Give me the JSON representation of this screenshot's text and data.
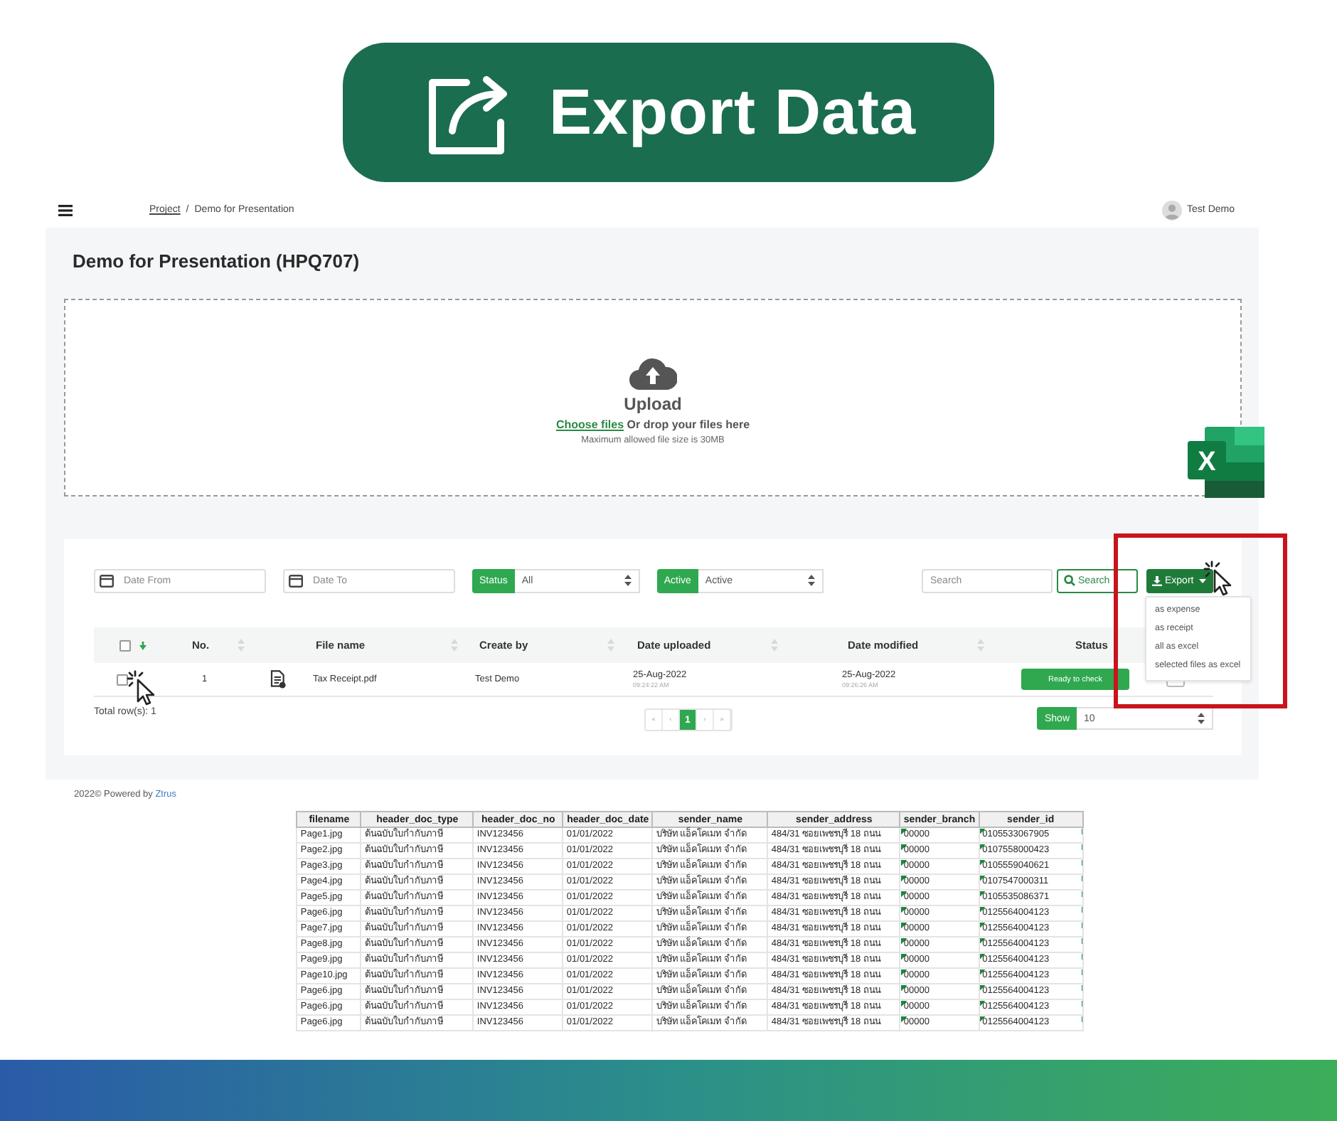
{
  "banner": {
    "title": "Export Data"
  },
  "topbar": {
    "breadcrumb": [
      {
        "label": "Project",
        "link": true
      },
      {
        "label": "Demo for Presentation",
        "link": false
      }
    ],
    "separator": "/",
    "user": "Test Demo"
  },
  "page": {
    "title": "Demo for Presentation (HPQ707)"
  },
  "upload": {
    "title": "Upload",
    "link": "Choose files",
    "text": " Or drop your files here",
    "note": "Maximum allowed file size is 30MB"
  },
  "filters": [
    {
      "kind": "date",
      "placeholder": "Date From"
    },
    {
      "kind": "date",
      "placeholder": "Date To"
    },
    {
      "kind": "select",
      "label": "Status",
      "value": "All"
    },
    {
      "kind": "select",
      "label": "Active",
      "value": "Active"
    }
  ],
  "search": {
    "placeholder": "Search",
    "button": "Search"
  },
  "export": {
    "label": "Export",
    "expanded": true,
    "menu": [
      "as expense",
      "as receipt",
      "all as excel",
      "selected files as excel"
    ]
  },
  "table": {
    "select_all": {
      "checked": false
    },
    "columns": [
      "No.",
      "File name",
      "Create by",
      "Date uploaded",
      "Date modified",
      "Status"
    ],
    "rows": [
      {
        "checked": false,
        "no": "1",
        "file": "Tax Receipt.pdf",
        "created_by": "Test Demo",
        "uploaded_date": "25-Aug-2022",
        "uploaded_time": "09:24:22 AM",
        "modified_date": "25-Aug-2022",
        "modified_time": "09:26:26 AM",
        "status": "Ready to check"
      }
    ],
    "total": "Total row(s): 1",
    "pages": [
      {
        "label": "«",
        "selected": false
      },
      {
        "label": "‹",
        "selected": false
      },
      {
        "label": "1",
        "selected": true
      },
      {
        "label": "›",
        "selected": false
      },
      {
        "label": "»",
        "selected": false
      }
    ],
    "page_size": {
      "label": "Show",
      "value": "10"
    }
  },
  "footer": {
    "text": "2022© Powered by ",
    "link": "Ztrus"
  },
  "excel_icon": {
    "letter": "X"
  },
  "spreadsheet": {
    "columns": [
      "filename",
      "header_doc_type",
      "header_doc_no",
      "header_doc_date",
      "sender_name",
      "sender_address",
      "sender_branch",
      "sender_id"
    ],
    "rows": [
      [
        "Page1.jpg",
        "ต้นฉบับใบกำกับภาษี",
        "INV123456",
        "01/01/2022",
        "บริษัท แอ็คโคเมท จำกัด",
        "484/31 ซอยเพชรบุรี 18 ถนน",
        "00000",
        "0105533067905"
      ],
      [
        "Page2.jpg",
        "ต้นฉบับใบกำกับภาษี",
        "INV123456",
        "01/01/2022",
        "บริษัท แอ็คโคเมท จำกัด",
        "484/31 ซอยเพชรบุรี 18 ถนน",
        "00000",
        "0107558000423"
      ],
      [
        "Page3.jpg",
        "ต้นฉบับใบกำกับภาษี",
        "INV123456",
        "01/01/2022",
        "บริษัท แอ็คโคเมท จำกัด",
        "484/31 ซอยเพชรบุรี 18 ถนน",
        "00000",
        "0105559040621"
      ],
      [
        "Page4.jpg",
        "ต้นฉบับใบกำกับภาษี",
        "INV123456",
        "01/01/2022",
        "บริษัท แอ็คโคเมท จำกัด",
        "484/31 ซอยเพชรบุรี 18 ถนน",
        "00000",
        "0107547000311"
      ],
      [
        "Page5.jpg",
        "ต้นฉบับใบกำกับภาษี",
        "INV123456",
        "01/01/2022",
        "บริษัท แอ็คโคเมท จำกัด",
        "484/31 ซอยเพชรบุรี 18 ถนน",
        "00000",
        "0105535086371"
      ],
      [
        "Page6.jpg",
        "ต้นฉบับใบกำกับภาษี",
        "INV123456",
        "01/01/2022",
        "บริษัท แอ็คโคเมท จำกัด",
        "484/31 ซอยเพชรบุรี 18 ถนน",
        "00000",
        "0125564004123"
      ],
      [
        "Page7.jpg",
        "ต้นฉบับใบกำกับภาษี",
        "INV123456",
        "01/01/2022",
        "บริษัท แอ็คโคเมท จำกัด",
        "484/31 ซอยเพชรบุรี 18 ถนน",
        "00000",
        "0125564004123"
      ],
      [
        "Page8.jpg",
        "ต้นฉบับใบกำกับภาษี",
        "INV123456",
        "01/01/2022",
        "บริษัท แอ็คโคเมท จำกัด",
        "484/31 ซอยเพชรบุรี 18 ถนน",
        "00000",
        "0125564004123"
      ],
      [
        "Page9.jpg",
        "ต้นฉบับใบกำกับภาษี",
        "INV123456",
        "01/01/2022",
        "บริษัท แอ็คโคเมท จำกัด",
        "484/31 ซอยเพชรบุรี 18 ถนน",
        "00000",
        "0125564004123"
      ],
      [
        "Page10.jpg",
        "ต้นฉบับใบกำกับภาษี",
        "INV123456",
        "01/01/2022",
        "บริษัท แอ็คโคเมท จำกัด",
        "484/31 ซอยเพชรบุรี 18 ถนน",
        "00000",
        "0125564004123"
      ],
      [
        "Page6.jpg",
        "ต้นฉบับใบกำกับภาษี",
        "INV123456",
        "01/01/2022",
        "บริษัท แอ็คโคเมท จำกัด",
        "484/31 ซอยเพชรบุรี 18 ถนน",
        "00000",
        "0125564004123"
      ],
      [
        "Page6.jpg",
        "ต้นฉบับใบกำกับภาษี",
        "INV123456",
        "01/01/2022",
        "บริษัท แอ็คโคเมท จำกัด",
        "484/31 ซอยเพชรบุรี 18 ถนน",
        "00000",
        "0125564004123"
      ],
      [
        "Page6.jpg",
        "ต้นฉบับใบกำกับภาษี",
        "INV123456",
        "01/01/2022",
        "บริษัท แอ็คโคเมท จำกัด",
        "484/31 ซอยเพชรบุรี 18 ถนน",
        "00000",
        "0125564004123"
      ]
    ]
  }
}
